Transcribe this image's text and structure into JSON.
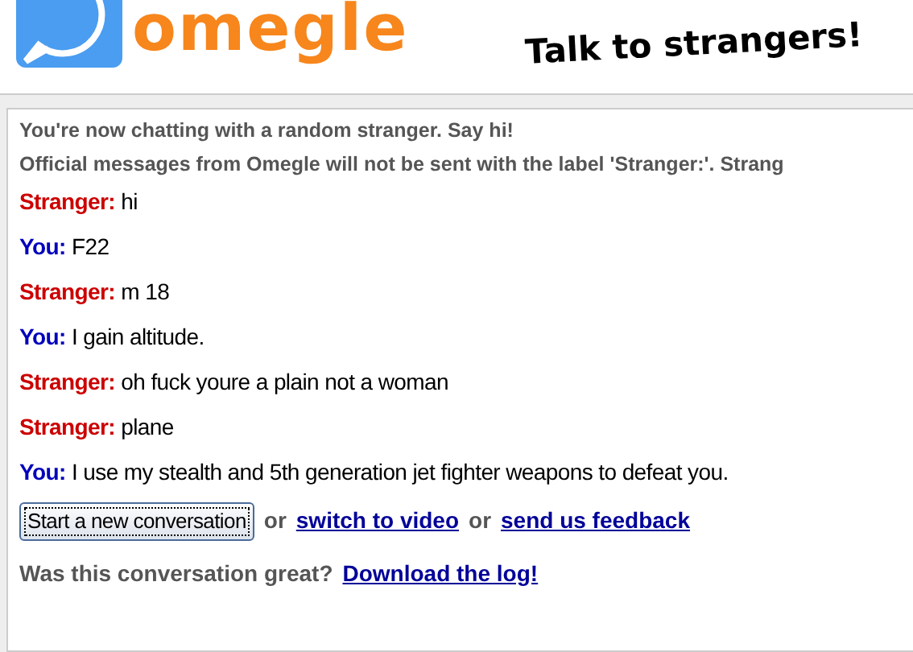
{
  "header": {
    "logo_text": "omegle",
    "tagline": "Talk to strangers!"
  },
  "system_messages": [
    "You're now chatting with a random stranger. Say hi!",
    "Official messages from Omegle will not be sent with the label 'Stranger:'. Strang"
  ],
  "messages": [
    {
      "kind": "stranger",
      "sender": "Stranger:",
      "text": "hi"
    },
    {
      "kind": "you",
      "sender": "You:",
      "text": "F22"
    },
    {
      "kind": "stranger",
      "sender": "Stranger:",
      "text": "m 18"
    },
    {
      "kind": "you",
      "sender": "You:",
      "text": "I gain altitude."
    },
    {
      "kind": "stranger",
      "sender": "Stranger:",
      "text": "oh fuck youre a plain not a woman"
    },
    {
      "kind": "stranger",
      "sender": "Stranger:",
      "text": "plane"
    },
    {
      "kind": "you",
      "sender": "You:",
      "text": "I use my stealth and 5th generation jet fighter weapons to defeat you."
    }
  ],
  "actions": [
    [
      {
        "kind": "button",
        "text": "Start a new conversation"
      },
      {
        "kind": "text",
        "text": "or"
      },
      {
        "kind": "link",
        "text": "switch to video"
      },
      {
        "kind": "text",
        "text": "or"
      },
      {
        "kind": "link",
        "text": "send us feedback"
      }
    ],
    [
      {
        "kind": "text",
        "text": "Was this conversation great?"
      },
      {
        "kind": "link",
        "text": "Download the log!"
      }
    ]
  ]
}
